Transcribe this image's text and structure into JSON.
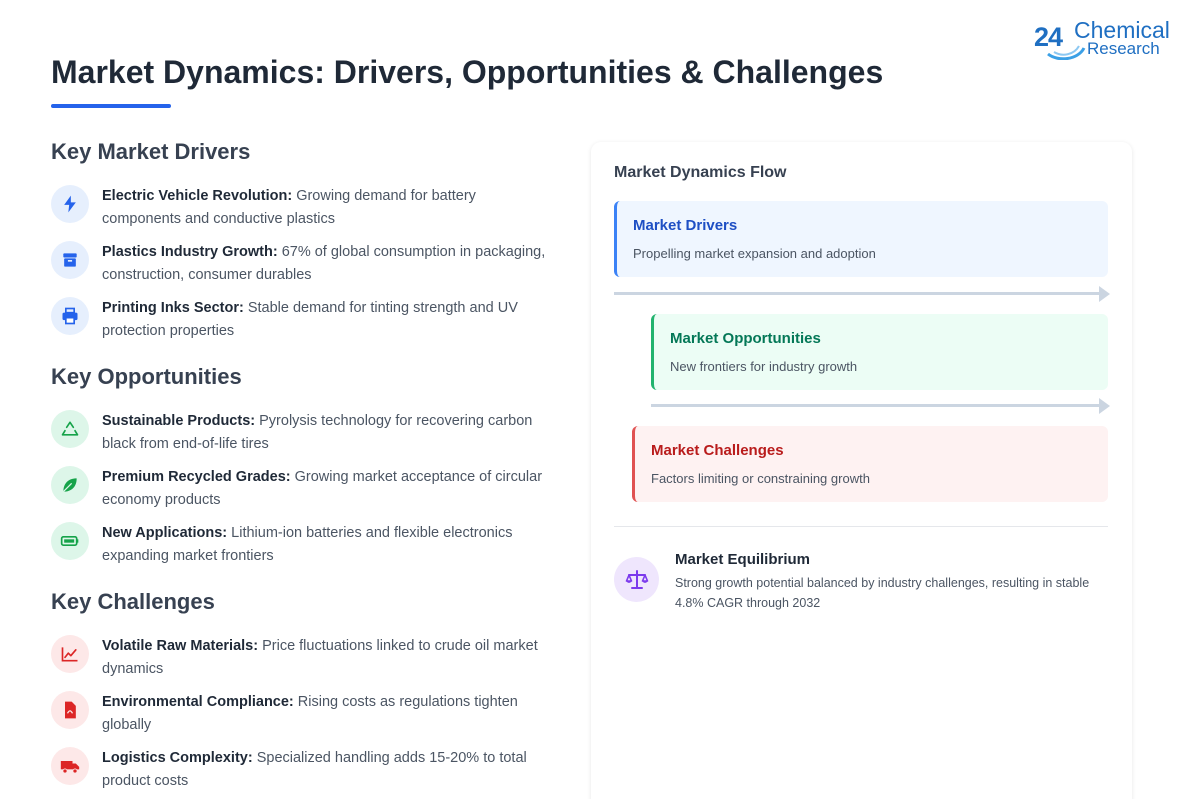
{
  "logo": {
    "number": "24",
    "line1": "Chemical",
    "line2": "Research"
  },
  "page": {
    "title": "Market Dynamics: Drivers, Opportunities & Challenges"
  },
  "drivers": {
    "title": "Key Market Drivers",
    "items": [
      {
        "icon": "lightning-bolt-icon",
        "label": "Electric Vehicle Revolution:",
        "text": "Growing demand for battery components and conductive plastics"
      },
      {
        "icon": "box-icon",
        "label": "Plastics Industry Growth:",
        "text": "67% of global consumption in packaging, construction, consumer durables"
      },
      {
        "icon": "printer-icon",
        "label": "Printing Inks Sector:",
        "text": "Stable demand for tinting strength and UV protection properties"
      }
    ]
  },
  "opportunities": {
    "title": "Key Opportunities",
    "items": [
      {
        "icon": "recycle-icon",
        "label": "Sustainable Products:",
        "text": "Pyrolysis technology for recovering carbon black from end-of-life tires"
      },
      {
        "icon": "leaf-icon",
        "label": "Premium Recycled Grades:",
        "text": "Growing market acceptance of circular economy products"
      },
      {
        "icon": "battery-icon",
        "label": "New Applications:",
        "text": "Lithium-ion batteries and flexible electronics expanding market frontiers"
      }
    ]
  },
  "challenges": {
    "title": "Key Challenges",
    "items": [
      {
        "icon": "line-chart-icon",
        "label": "Volatile Raw Materials:",
        "text": "Price fluctuations linked to crude oil market dynamics"
      },
      {
        "icon": "document-icon",
        "label": "Environmental Compliance:",
        "text": "Rising costs as regulations tighten globally"
      },
      {
        "icon": "truck-icon",
        "label": "Logistics Complexity:",
        "text": "Specialized handling adds 15-20% to total product costs"
      }
    ]
  },
  "flow": {
    "title": "Market Dynamics Flow",
    "drivers": {
      "head": "Market Drivers",
      "sub": "Propelling market expansion and adoption"
    },
    "opportunities": {
      "head": "Market Opportunities",
      "sub": "New frontiers for industry growth"
    },
    "challenges": {
      "head": "Market Challenges",
      "sub": "Factors limiting or constraining growth"
    }
  },
  "equilibrium": {
    "icon": "balance-scale-icon",
    "title": "Market Equilibrium",
    "text": "Strong growth potential balanced by industry challenges, resulting in stable 4.8% CAGR through 2032"
  },
  "colors": {
    "accent": "#2563eb",
    "drivers": "#3b82f6",
    "opportunities": "#22b36e",
    "challenges": "#e05252",
    "equilibrium": "#7c3aed"
  }
}
